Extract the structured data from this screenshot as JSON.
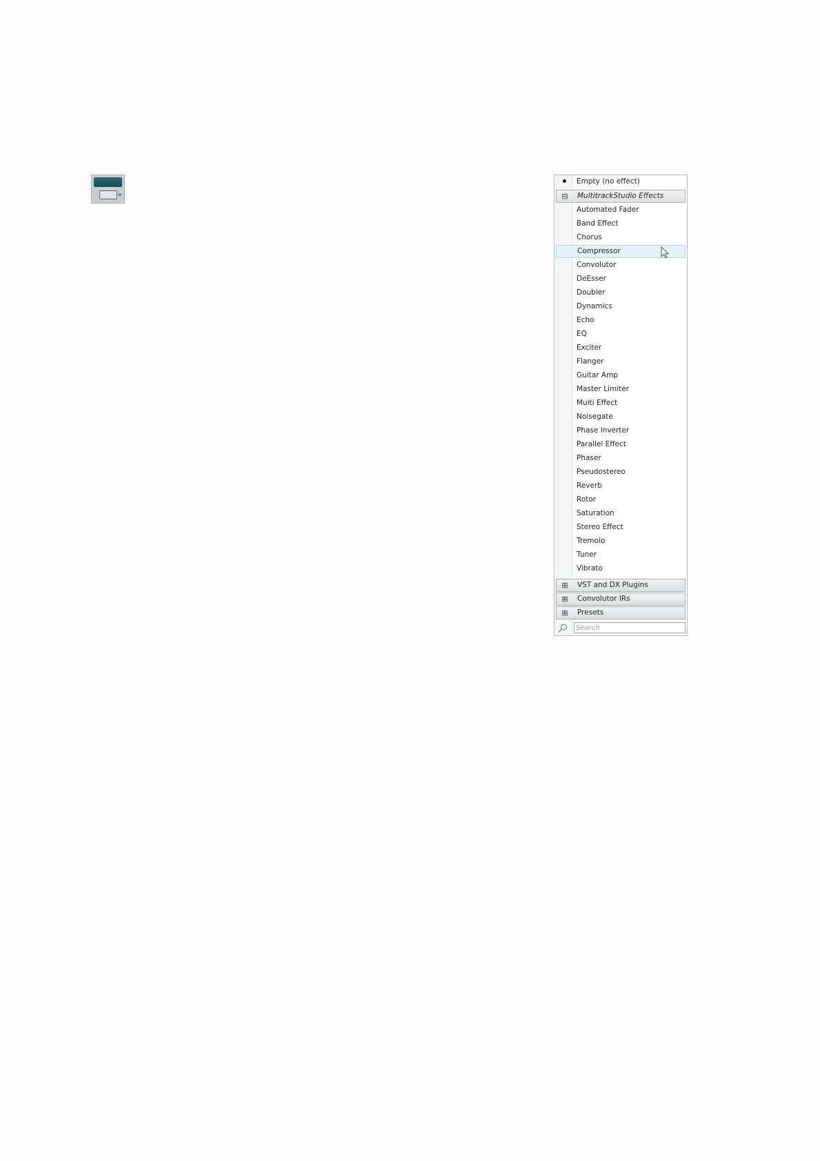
{
  "menu": {
    "empty_item": "Empty (no effect)",
    "groups": {
      "multitrack": "MultitrackStudio Effects",
      "vst": "VST and DX Plugins",
      "convolutor_irs": "Convolutor IRs",
      "presets": "Presets"
    },
    "group_icons": {
      "expanded": "⊟",
      "collapsed": "⊞"
    },
    "effects": [
      "Automated Fader",
      "Band Effect",
      "Chorus",
      "Compressor",
      "Convolutor",
      "DeEsser",
      "Doubler",
      "Dynamics",
      "Echo",
      "EQ",
      "Exciter",
      "Flanger",
      "Guitar Amp",
      "Master Limiter",
      "Multi Effect",
      "Noisegate",
      "Phase Inverter",
      "Parallel Effect",
      "Phaser",
      "Pseudostereo",
      "Reverb",
      "Rotor",
      "Saturation",
      "Stereo Effect",
      "Tremolo",
      "Tuner",
      "Vibrato"
    ],
    "highlighted_item": "Compressor",
    "search": {
      "placeholder": "Search",
      "value": ""
    }
  },
  "icons": {
    "slot_widget": "insert-slot-icon",
    "cursor": "mouse-pointer-icon",
    "search": "search-icon"
  },
  "colors": {
    "slot_teal": "#164b52",
    "highlight_bg": "#e3f1f8",
    "highlight_border": "#a9d6ee"
  }
}
